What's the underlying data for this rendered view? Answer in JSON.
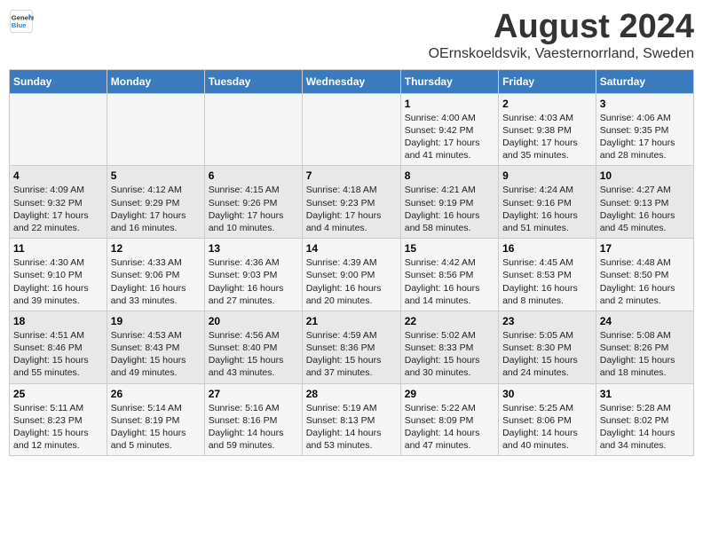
{
  "logo": {
    "general": "General",
    "blue": "Blue"
  },
  "title": {
    "month": "August 2024",
    "location": "OErnskoeldsvik, Vaesternorrland, Sweden"
  },
  "headers": [
    "Sunday",
    "Monday",
    "Tuesday",
    "Wednesday",
    "Thursday",
    "Friday",
    "Saturday"
  ],
  "weeks": [
    [
      {
        "day": "",
        "info": ""
      },
      {
        "day": "",
        "info": ""
      },
      {
        "day": "",
        "info": ""
      },
      {
        "day": "",
        "info": ""
      },
      {
        "day": "1",
        "info": "Sunrise: 4:00 AM\nSunset: 9:42 PM\nDaylight: 17 hours\nand 41 minutes."
      },
      {
        "day": "2",
        "info": "Sunrise: 4:03 AM\nSunset: 9:38 PM\nDaylight: 17 hours\nand 35 minutes."
      },
      {
        "day": "3",
        "info": "Sunrise: 4:06 AM\nSunset: 9:35 PM\nDaylight: 17 hours\nand 28 minutes."
      }
    ],
    [
      {
        "day": "4",
        "info": "Sunrise: 4:09 AM\nSunset: 9:32 PM\nDaylight: 17 hours\nand 22 minutes."
      },
      {
        "day": "5",
        "info": "Sunrise: 4:12 AM\nSunset: 9:29 PM\nDaylight: 17 hours\nand 16 minutes."
      },
      {
        "day": "6",
        "info": "Sunrise: 4:15 AM\nSunset: 9:26 PM\nDaylight: 17 hours\nand 10 minutes."
      },
      {
        "day": "7",
        "info": "Sunrise: 4:18 AM\nSunset: 9:23 PM\nDaylight: 17 hours\nand 4 minutes."
      },
      {
        "day": "8",
        "info": "Sunrise: 4:21 AM\nSunset: 9:19 PM\nDaylight: 16 hours\nand 58 minutes."
      },
      {
        "day": "9",
        "info": "Sunrise: 4:24 AM\nSunset: 9:16 PM\nDaylight: 16 hours\nand 51 minutes."
      },
      {
        "day": "10",
        "info": "Sunrise: 4:27 AM\nSunset: 9:13 PM\nDaylight: 16 hours\nand 45 minutes."
      }
    ],
    [
      {
        "day": "11",
        "info": "Sunrise: 4:30 AM\nSunset: 9:10 PM\nDaylight: 16 hours\nand 39 minutes."
      },
      {
        "day": "12",
        "info": "Sunrise: 4:33 AM\nSunset: 9:06 PM\nDaylight: 16 hours\nand 33 minutes."
      },
      {
        "day": "13",
        "info": "Sunrise: 4:36 AM\nSunset: 9:03 PM\nDaylight: 16 hours\nand 27 minutes."
      },
      {
        "day": "14",
        "info": "Sunrise: 4:39 AM\nSunset: 9:00 PM\nDaylight: 16 hours\nand 20 minutes."
      },
      {
        "day": "15",
        "info": "Sunrise: 4:42 AM\nSunset: 8:56 PM\nDaylight: 16 hours\nand 14 minutes."
      },
      {
        "day": "16",
        "info": "Sunrise: 4:45 AM\nSunset: 8:53 PM\nDaylight: 16 hours\nand 8 minutes."
      },
      {
        "day": "17",
        "info": "Sunrise: 4:48 AM\nSunset: 8:50 PM\nDaylight: 16 hours\nand 2 minutes."
      }
    ],
    [
      {
        "day": "18",
        "info": "Sunrise: 4:51 AM\nSunset: 8:46 PM\nDaylight: 15 hours\nand 55 minutes."
      },
      {
        "day": "19",
        "info": "Sunrise: 4:53 AM\nSunset: 8:43 PM\nDaylight: 15 hours\nand 49 minutes."
      },
      {
        "day": "20",
        "info": "Sunrise: 4:56 AM\nSunset: 8:40 PM\nDaylight: 15 hours\nand 43 minutes."
      },
      {
        "day": "21",
        "info": "Sunrise: 4:59 AM\nSunset: 8:36 PM\nDaylight: 15 hours\nand 37 minutes."
      },
      {
        "day": "22",
        "info": "Sunrise: 5:02 AM\nSunset: 8:33 PM\nDaylight: 15 hours\nand 30 minutes."
      },
      {
        "day": "23",
        "info": "Sunrise: 5:05 AM\nSunset: 8:30 PM\nDaylight: 15 hours\nand 24 minutes."
      },
      {
        "day": "24",
        "info": "Sunrise: 5:08 AM\nSunset: 8:26 PM\nDaylight: 15 hours\nand 18 minutes."
      }
    ],
    [
      {
        "day": "25",
        "info": "Sunrise: 5:11 AM\nSunset: 8:23 PM\nDaylight: 15 hours\nand 12 minutes."
      },
      {
        "day": "26",
        "info": "Sunrise: 5:14 AM\nSunset: 8:19 PM\nDaylight: 15 hours\nand 5 minutes."
      },
      {
        "day": "27",
        "info": "Sunrise: 5:16 AM\nSunset: 8:16 PM\nDaylight: 14 hours\nand 59 minutes."
      },
      {
        "day": "28",
        "info": "Sunrise: 5:19 AM\nSunset: 8:13 PM\nDaylight: 14 hours\nand 53 minutes."
      },
      {
        "day": "29",
        "info": "Sunrise: 5:22 AM\nSunset: 8:09 PM\nDaylight: 14 hours\nand 47 minutes."
      },
      {
        "day": "30",
        "info": "Sunrise: 5:25 AM\nSunset: 8:06 PM\nDaylight: 14 hours\nand 40 minutes."
      },
      {
        "day": "31",
        "info": "Sunrise: 5:28 AM\nSunset: 8:02 PM\nDaylight: 14 hours\nand 34 minutes."
      }
    ]
  ]
}
